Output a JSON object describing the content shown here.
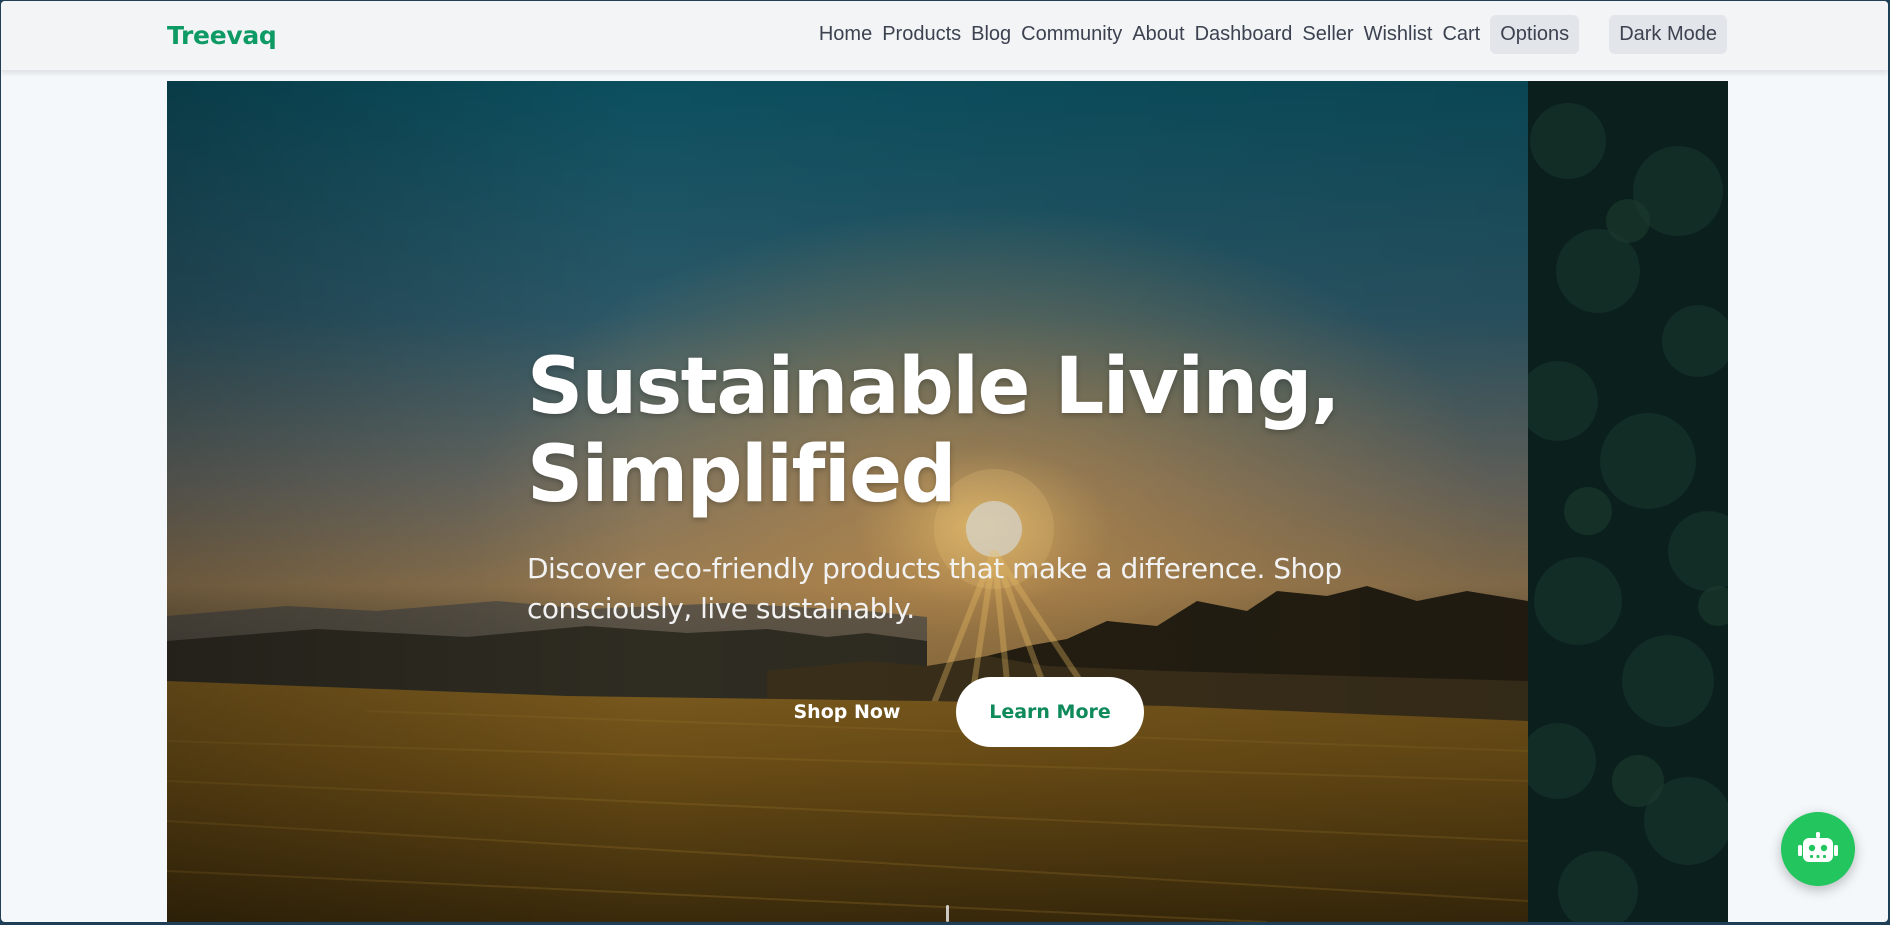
{
  "brand": {
    "logo_text": "Treevaq",
    "accent_color": "#0e9a64"
  },
  "nav": {
    "links": [
      "Home",
      "Products",
      "Blog",
      "Community",
      "About",
      "Dashboard",
      "Seller",
      "Wishlist",
      "Cart"
    ],
    "options_label": "Options",
    "dark_mode_label": "Dark Mode"
  },
  "hero": {
    "title_line1": "Sustainable Living,",
    "title_line2": "Simplified",
    "subtitle": "Discover eco-friendly products that make a difference. Shop consciously, live sustainably.",
    "primary_button": "Shop Now",
    "secondary_button": "Learn More",
    "background_image": "sunset over wheat field",
    "side_image": "forest tree canopy"
  },
  "chat": {
    "icon": "robot-icon",
    "color": "#22c55e"
  }
}
